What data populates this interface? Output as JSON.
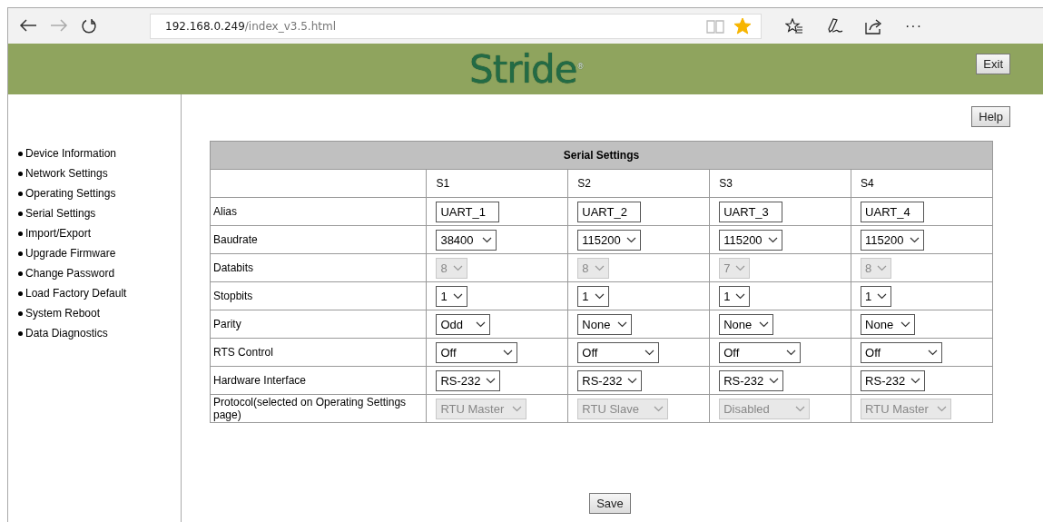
{
  "browser": {
    "url_host": "192.168.0.249",
    "url_path": "/index_v3.5.html",
    "favorite": true,
    "more": "···"
  },
  "header": {
    "logo": "Stride$^{®}$",
    "exit_button": "Exit"
  },
  "sidebar": {
    "items": [
      {
        "label": "Device Information"
      },
      {
        "label": "Network Settings"
      },
      {
        "label": "Operating Settings"
      },
      {
        "label": "Serial Settings"
      },
      {
        "label": "Import/Export"
      },
      {
        "label": "Upgrade Firmware"
      },
      {
        "label": "Change Password"
      },
      {
        "label": "Load Factory Default"
      },
      {
        "label": "System Reboot"
      },
      {
        "label": "Data Diagnostics"
      }
    ]
  },
  "help_button": "Help",
  "table": {
    "title": "Serial Settings",
    "columns": [
      "S1",
      "S2",
      "S3",
      "S4"
    ],
    "rows": [
      {
        "label": "Alias",
        "kind": "text",
        "cells": [
          {
            "value": "UART_1",
            "disabled": false
          },
          {
            "value": "UART_2",
            "disabled": false
          },
          {
            "value": "UART_3",
            "disabled": false
          },
          {
            "value": "UART_4",
            "disabled": false
          }
        ]
      },
      {
        "label": "Baudrate",
        "kind": "select",
        "cells": [
          {
            "value": "38400",
            "disabled": false
          },
          {
            "value": "115200",
            "disabled": false
          },
          {
            "value": "115200",
            "disabled": false
          },
          {
            "value": "115200",
            "disabled": false
          }
        ]
      },
      {
        "label": "Databits",
        "kind": "select",
        "cells": [
          {
            "value": "8",
            "disabled": true
          },
          {
            "value": "8",
            "disabled": true
          },
          {
            "value": "7",
            "disabled": true
          },
          {
            "value": "8",
            "disabled": true
          }
        ]
      },
      {
        "label": "Stopbits",
        "kind": "select",
        "cells": [
          {
            "value": "1",
            "disabled": false
          },
          {
            "value": "1",
            "disabled": false
          },
          {
            "value": "1",
            "disabled": false
          },
          {
            "value": "1",
            "disabled": false
          }
        ]
      },
      {
        "label": "Parity",
        "kind": "select",
        "cells": [
          {
            "value": "Odd",
            "disabled": false
          },
          {
            "value": "None",
            "disabled": false
          },
          {
            "value": "None",
            "disabled": false
          },
          {
            "value": "None",
            "disabled": false
          }
        ]
      },
      {
        "label": "RTS Control",
        "kind": "select",
        "cells": [
          {
            "value": "Off",
            "disabled": false
          },
          {
            "value": "Off",
            "disabled": false
          },
          {
            "value": "Off",
            "disabled": false
          },
          {
            "value": "Off",
            "disabled": false
          }
        ]
      },
      {
        "label": "Hardware Interface",
        "kind": "select",
        "cells": [
          {
            "value": "RS-232",
            "disabled": false
          },
          {
            "value": "RS-232",
            "disabled": false
          },
          {
            "value": "RS-232",
            "disabled": false
          },
          {
            "value": "RS-232",
            "disabled": false
          }
        ]
      },
      {
        "label": "Protocol(selected on Operating Settings page)",
        "kind": "select",
        "cells": [
          {
            "value": "RTU Master",
            "disabled": true
          },
          {
            "value": "RTU Slave",
            "disabled": true
          },
          {
            "value": "Disabled",
            "disabled": true
          },
          {
            "value": "RTU Master",
            "disabled": true
          }
        ]
      }
    ]
  },
  "save_button": "Save"
}
